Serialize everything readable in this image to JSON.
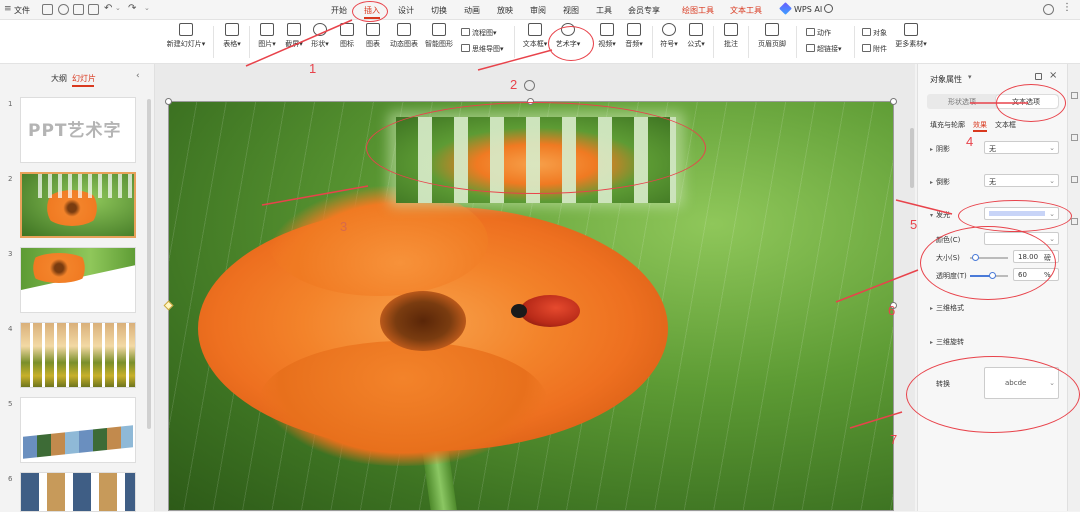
{
  "menubar": {
    "file_label": "文件",
    "tabs": [
      {
        "label": "开始",
        "state": "normal"
      },
      {
        "label": "插入",
        "state": "active"
      },
      {
        "label": "设计",
        "state": "normal"
      },
      {
        "label": "切换",
        "state": "normal"
      },
      {
        "label": "动画",
        "state": "normal"
      },
      {
        "label": "放映",
        "state": "normal"
      },
      {
        "label": "审阅",
        "state": "normal"
      },
      {
        "label": "视图",
        "state": "normal"
      },
      {
        "label": "工具",
        "state": "normal"
      },
      {
        "label": "会员专享",
        "state": "normal"
      },
      {
        "label": "绘图工具",
        "state": "special"
      },
      {
        "label": "文本工具",
        "state": "special"
      },
      {
        "label": "WPS AI",
        "state": "normal"
      }
    ]
  },
  "ribbon": {
    "new_slide": "新建幻灯片",
    "table": "表格",
    "picture": "图片",
    "screenshot": "截屏",
    "shape": "形状",
    "icon": "图标",
    "chart": "图表",
    "dynamic_chart": "动态图表",
    "smart_graphic": "智能图形",
    "flowchart": "流程图",
    "mindmap": "思维导图",
    "textbox": "文本框",
    "wordart": "艺术字",
    "video": "视频",
    "audio": "音频",
    "symbol": "符号",
    "formula": "公式",
    "comment": "批注",
    "header_footer": "页眉页脚",
    "action": "动作",
    "hyperlink": "超链接",
    "object": "对象",
    "attachment": "附件",
    "more_material": "更多素材"
  },
  "left_panel": {
    "tab_outline": "大纲",
    "tab_slides": "幻灯片",
    "slide_numbers": [
      "1",
      "2",
      "3",
      "4",
      "5",
      "6"
    ],
    "slide1_text": "PPT艺术字"
  },
  "right_panel": {
    "title": "对象属性",
    "tab_shape": "形状选项",
    "tab_text": "文本选项",
    "subtab_fill": "填充与轮廓",
    "subtab_effect": "效果",
    "subtab_textbox": "文本框",
    "shadow_label": "阴影",
    "shadow_value": "无",
    "reflection_label": "倒影",
    "reflection_value": "无",
    "glow_label": "发光",
    "color_label": "颜色(C)",
    "size_label": "大小(S)",
    "size_value": "18.00",
    "size_unit": "磅",
    "transparency_label": "透明度(T)",
    "transparency_value": "60",
    "transparency_unit": "%",
    "threed_format": "三维格式",
    "threed_rotation": "三维旋转",
    "transform_label": "转换",
    "transform_preview": "abcde"
  },
  "annotations": [
    "1",
    "2",
    "3",
    "4",
    "5",
    "6",
    "7"
  ],
  "colors": {
    "accent": "#d9381e",
    "annotation_red": "#e8434b",
    "slide_green": "#5d9b34",
    "flower_orange": "#f07a22"
  }
}
